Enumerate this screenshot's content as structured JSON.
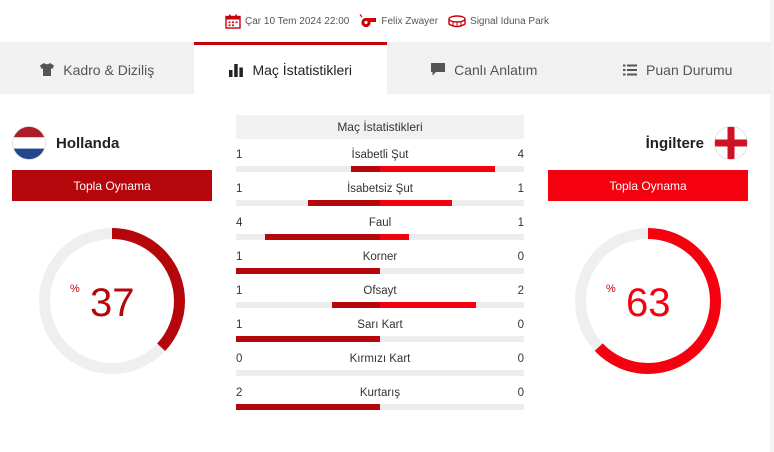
{
  "match_info": {
    "datetime": "Çar 10 Tem 2024 22:00",
    "referee": "Felix Zwayer",
    "stadium": "Signal Iduna Park"
  },
  "tabs": [
    {
      "label": "Kadro & Diziliş",
      "icon": "shirt-icon",
      "active": false
    },
    {
      "label": "Maç İstatistikleri",
      "icon": "bar-chart-icon",
      "active": true
    },
    {
      "label": "Canlı Anlatım",
      "icon": "speech-bubble-icon",
      "active": false
    },
    {
      "label": "Puan Durumu",
      "icon": "list-icon",
      "active": false
    }
  ],
  "home": {
    "name": "Hollanda",
    "flag_icon": "netherlands-flag-icon",
    "possession_label": "Topla Oynama",
    "possession_sign": "%",
    "possession": 37,
    "color": "#b5060b"
  },
  "away": {
    "name": "İngiltere",
    "flag_icon": "england-flag-icon",
    "possession_label": "Topla Oynama",
    "possession_sign": "%",
    "possession": 63,
    "color": "#f4000e"
  },
  "stats": {
    "title": "Maç İstatistikleri",
    "rows": [
      {
        "label": "İsabetli Şut",
        "home": 1,
        "away": 4
      },
      {
        "label": "İsabetsiz Şut",
        "home": 1,
        "away": 1
      },
      {
        "label": "Faul",
        "home": 4,
        "away": 1
      },
      {
        "label": "Korner",
        "home": 1,
        "away": 0
      },
      {
        "label": "Ofsayt",
        "home": 1,
        "away": 2
      },
      {
        "label": "Sarı Kart",
        "home": 1,
        "away": 0
      },
      {
        "label": "Kırmızı Kart",
        "home": 0,
        "away": 0
      },
      {
        "label": "Kurtarış",
        "home": 2,
        "away": 0
      }
    ]
  }
}
